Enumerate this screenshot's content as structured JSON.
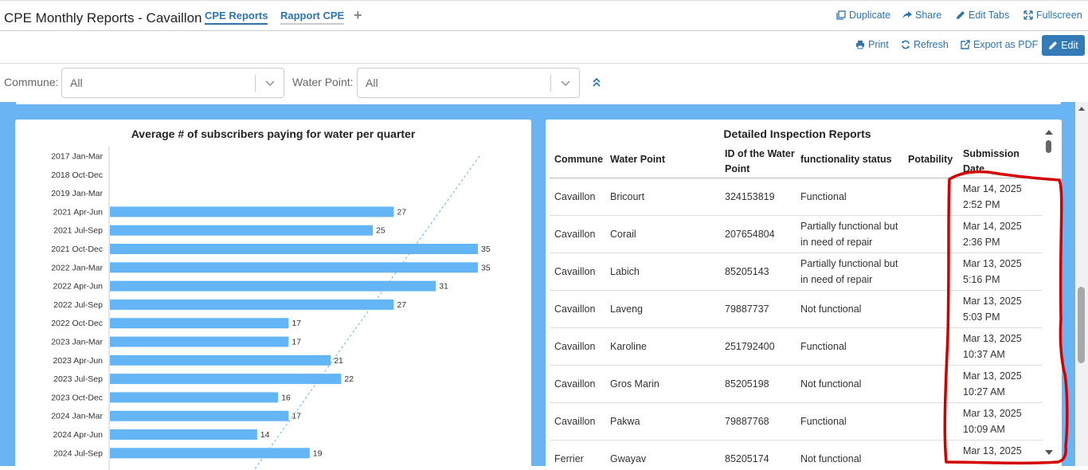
{
  "header": {
    "title": "CPE Monthly Reports - Cavaillon",
    "tabs": [
      {
        "label": "CPE Reports"
      },
      {
        "label": "Rapport CPE"
      }
    ],
    "add_tab_label": "+",
    "actions": {
      "duplicate": "Duplicate",
      "share": "Share",
      "edit_tabs": "Edit Tabs",
      "fullscreen": "Fullscreen"
    }
  },
  "toolbar": {
    "print": "Print",
    "refresh": "Refresh",
    "export_pdf": "Export as PDF",
    "edit": "Edit"
  },
  "filters": {
    "commune": {
      "label": "Commune:",
      "value": "All"
    },
    "water_point": {
      "label": "Water Point:",
      "value": "All"
    }
  },
  "chart": {
    "title": "Average # of subscribers paying for water per quarter",
    "bar_color": "#64b5f6",
    "trend_color": "#64b5f6"
  },
  "chart_data": {
    "type": "bar",
    "orientation": "horizontal",
    "title": "Average # of subscribers paying for water per quarter",
    "xlabel": "",
    "ylabel": "",
    "xlim": [
      0,
      40
    ],
    "grid": false,
    "trendline": "dashed linear",
    "categories": [
      "2017 Jan-Mar",
      "2018 Oct-Dec",
      "2019 Jan-Mar",
      "2021 Apr-Jun",
      "2021 Jul-Sep",
      "2021 Oct-Dec",
      "2022 Jan-Mar",
      "2022 Apr-Jun",
      "2022 Jul-Sep",
      "2022 Oct-Dec",
      "2023 Jan-Mar",
      "2023 Apr-Jun",
      "2023 Jul-Sep",
      "2023 Oct-Dec",
      "2024 Jan-Mar",
      "2024 Apr-Jun",
      "2024 Jul-Sep"
    ],
    "values": [
      null,
      null,
      null,
      27,
      25,
      35,
      35,
      31,
      27,
      17,
      17,
      21,
      22,
      16,
      17,
      14,
      19
    ]
  },
  "table": {
    "title": "Detailed Inspection Reports",
    "columns": [
      "Commune",
      "Water Point",
      "ID of the Water Point",
      "functionality status",
      "Potability",
      "Submission Date"
    ],
    "rows": [
      {
        "commune": "Cavaillon",
        "water_point": "Bricourt",
        "id": "324153819",
        "status": "Functional",
        "potability": "",
        "date": "Mar 14, 2025",
        "time": "2:52 PM"
      },
      {
        "commune": "Cavaillon",
        "water_point": "Corail",
        "id": "207654804",
        "status": "Partially functional but in need of repair",
        "potability": "",
        "date": "Mar 14, 2025",
        "time": "2:36 PM"
      },
      {
        "commune": "Cavaillon",
        "water_point": "Labich",
        "id": "85205143",
        "status": "Partially functional but in need of repair",
        "potability": "",
        "date": "Mar 13, 2025",
        "time": "5:16 PM"
      },
      {
        "commune": "Cavaillon",
        "water_point": "Laveng",
        "id": "79887737",
        "status": "Not functional",
        "potability": "",
        "date": "Mar 13, 2025",
        "time": "5:03 PM"
      },
      {
        "commune": "Cavaillon",
        "water_point": "Karoline",
        "id": "251792400",
        "status": "Functional",
        "potability": "",
        "date": "Mar 13, 2025",
        "time": "10:37 AM"
      },
      {
        "commune": "Cavaillon",
        "water_point": "Gros Marin",
        "id": "85205198",
        "status": "Not functional",
        "potability": "",
        "date": "Mar 13, 2025",
        "time": "10:27 AM"
      },
      {
        "commune": "Cavaillon",
        "water_point": "Pakwa",
        "id": "79887768",
        "status": "Functional",
        "potability": "",
        "date": "Mar 13, 2025",
        "time": "10:09 AM"
      },
      {
        "commune": "Ferrier",
        "water_point": "Gwayav",
        "id": "85205174",
        "status": "Not functional",
        "potability": "",
        "date": "Mar 13, 2025",
        "time": ""
      }
    ]
  },
  "annotation": {
    "color": "#d40000"
  },
  "icons": {
    "duplicate": "copy-icon",
    "share": "share-icon",
    "edit_tabs": "pencil-icon",
    "fullscreen": "expand-icon",
    "print": "print-icon",
    "refresh": "refresh-icon",
    "export_pdf": "export-icon",
    "edit": "pencil-icon",
    "collapse": "double-chevron-up-icon"
  }
}
